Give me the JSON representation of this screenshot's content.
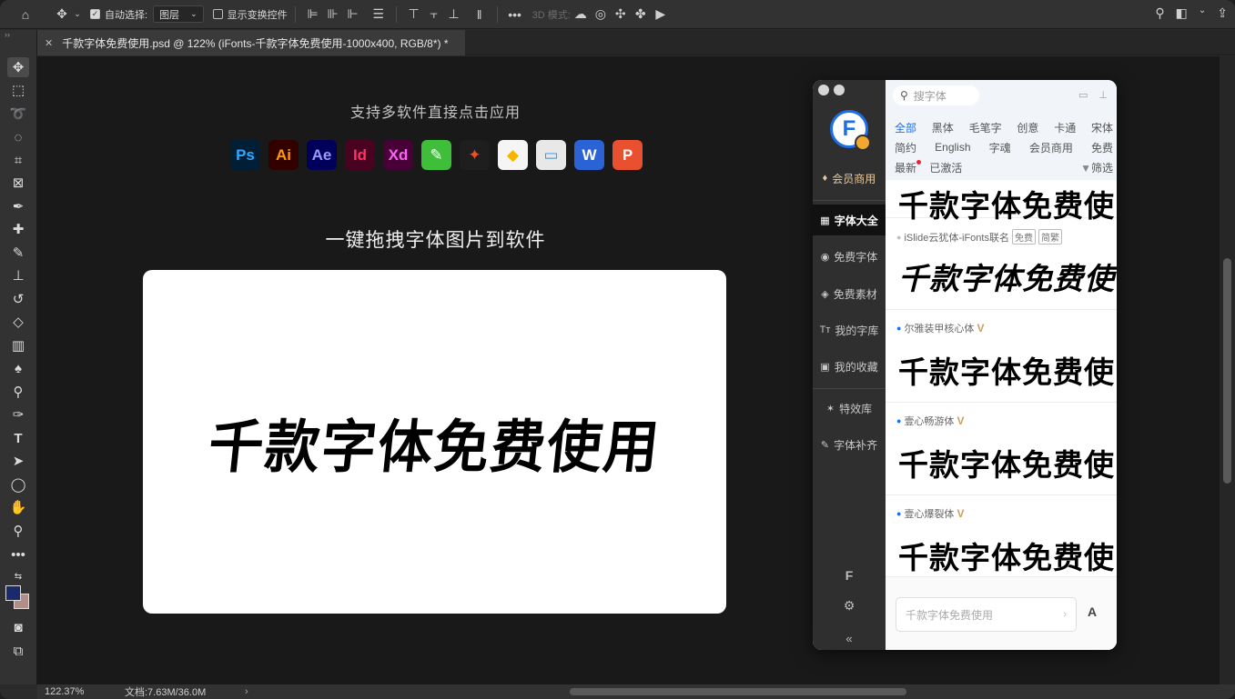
{
  "options_bar": {
    "auto_select_label": "自动选择:",
    "auto_select_value": "图层",
    "show_transform_label": "显示变换控件",
    "mode_3d_label": "3D 模式:"
  },
  "document_tab": {
    "title": "千款字体免费使用.psd @ 122% (iFonts-千款字体免费使用-1000x400, RGB/8*) *"
  },
  "canvas": {
    "subtitle": "支持多软件直接点击应用",
    "headline": "一键拖拽字体图片到软件",
    "card_text": "千款字体免费使用",
    "app_icons": [
      {
        "label": "Ps",
        "bg": "#001e36",
        "fg": "#31a8ff"
      },
      {
        "label": "Ai",
        "bg": "#330000",
        "fg": "#ff9a00"
      },
      {
        "label": "Ae",
        "bg": "#00005b",
        "fg": "#9999ff"
      },
      {
        "label": "Id",
        "bg": "#49021f",
        "fg": "#ff3366"
      },
      {
        "label": "Xd",
        "bg": "#470137",
        "fg": "#ff61f6"
      },
      {
        "label": "",
        "bg": "#3fbe3a",
        "fg": "#ffffff"
      },
      {
        "label": "",
        "bg": "#1e1e1e",
        "fg": "#f24e1e"
      },
      {
        "label": "",
        "bg": "#f5f5f5",
        "fg": "#f7b500"
      },
      {
        "label": "",
        "bg": "#e8e8e8",
        "fg": "#3d8fe0"
      },
      {
        "label": "W",
        "bg": "#2b63d6",
        "fg": "#ffffff"
      },
      {
        "label": "P",
        "bg": "#e8502f",
        "fg": "#ffffff"
      }
    ]
  },
  "status_bar": {
    "zoom": "122.37%",
    "doc_size": "文档:7.63M/36.0M",
    "arrow": "›"
  },
  "ifonts": {
    "search_placeholder": "搜字体",
    "nav": [
      {
        "label": "会员商用",
        "icon": "diamond-icon"
      },
      {
        "label": "字体大全",
        "icon": "grid-icon"
      },
      {
        "label": "免费字体",
        "icon": "free-icon"
      },
      {
        "label": "免费素材",
        "icon": "layers-icon"
      },
      {
        "label": "我的字库",
        "icon": "font-icon"
      },
      {
        "label": "我的收藏",
        "icon": "folder-icon"
      },
      {
        "label": "特效库",
        "icon": "effects-icon"
      },
      {
        "label": "字体补齐",
        "icon": "wrench-icon"
      }
    ],
    "categories_row1": [
      "全部",
      "黑体",
      "毛笔字",
      "创意",
      "卡通",
      "宋体"
    ],
    "categories_row2": [
      "简约",
      "English",
      "字魂",
      "会员商用",
      "免费"
    ],
    "latest_label": "最新",
    "activated_label": "已激活",
    "filter_label": "筛选",
    "fonts": [
      {
        "name": "",
        "sample": "千款字体免费使"
      },
      {
        "name": "iSlide云犹体-iFonts联名",
        "tag1": "免费",
        "tag2": "简繁",
        "sample": "千款字体免费使"
      },
      {
        "name": "尔雅装甲核心体",
        "vip": "V",
        "sample": "千款字体免费使"
      },
      {
        "name": "壹心畅游体",
        "vip": "V",
        "sample": "千款字体免费使"
      },
      {
        "name": "壹心爆裂体",
        "vip": "V",
        "sample": "千款字体免费使"
      }
    ],
    "preview_input": "千款字体免费使用",
    "preview_button": "A",
    "collapse_label": "«"
  }
}
